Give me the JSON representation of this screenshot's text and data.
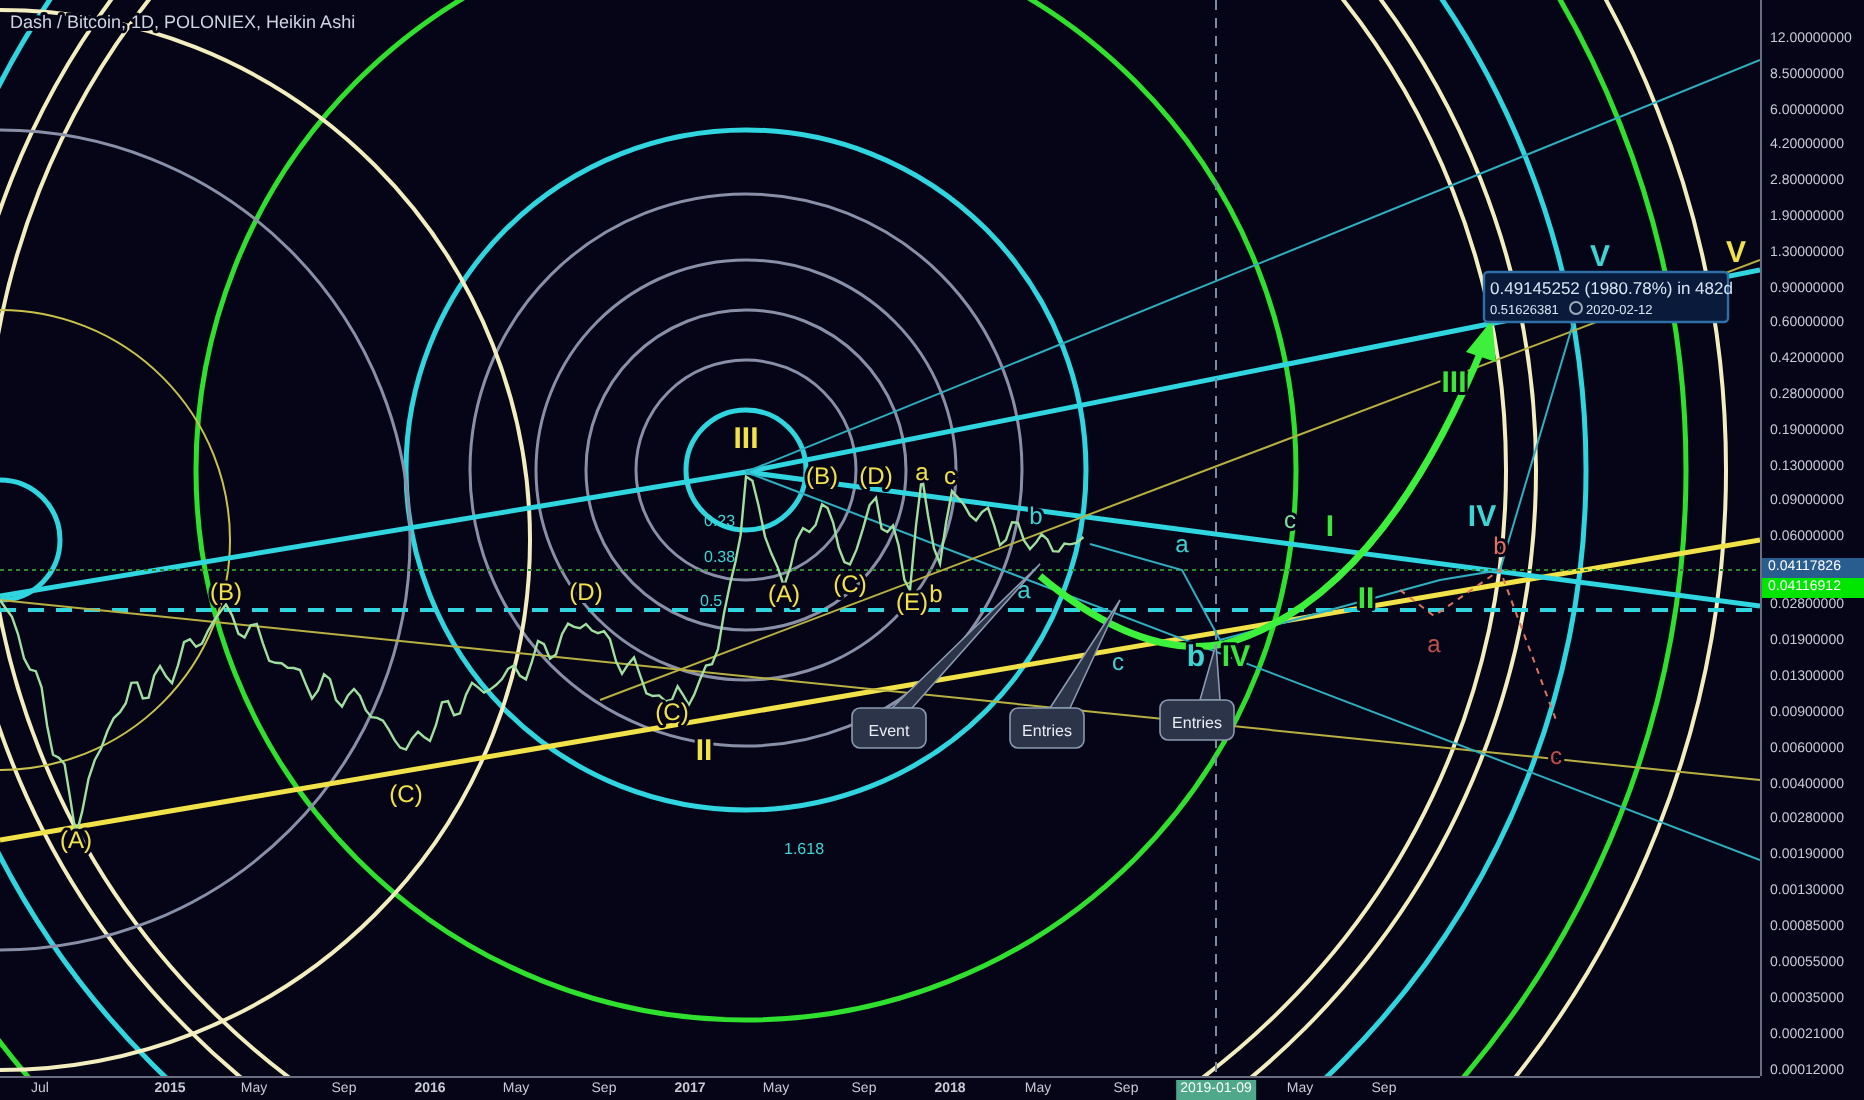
{
  "title": "Dash / Bitcoin, 1D, POLONIEX, Heikin Ashi",
  "price_axis": [
    "12.00000000",
    "8.50000000",
    "6.00000000",
    "4.20000000",
    "2.80000000",
    "1.90000000",
    "1.30000000",
    "0.90000000",
    "0.60000000",
    "0.42000000",
    "0.28000000",
    "0.19000000",
    "0.13000000",
    "0.09000000",
    "0.06000000",
    "0.02800000",
    "0.01900000",
    "0.01300000",
    "0.00900000",
    "0.00600000",
    "0.00400000",
    "0.00280000",
    "0.00190000",
    "0.00130000",
    "0.00085000",
    "0.00055000",
    "0.00035000",
    "0.00021000",
    "0.00012000"
  ],
  "current_prices": [
    {
      "value": "0.04117826",
      "color": "#2a5d8f"
    },
    {
      "value": "0.04116912",
      "color": "#00e600"
    }
  ],
  "time_axis": [
    {
      "label": "Jul",
      "kind": "month",
      "highlighted": false
    },
    {
      "label": "2015",
      "kind": "year",
      "highlighted": false
    },
    {
      "label": "May",
      "kind": "month",
      "highlighted": false
    },
    {
      "label": "Sep",
      "kind": "month",
      "highlighted": false
    },
    {
      "label": "2016",
      "kind": "year",
      "highlighted": false
    },
    {
      "label": "May",
      "kind": "month",
      "highlighted": false
    },
    {
      "label": "Sep",
      "kind": "month",
      "highlighted": false
    },
    {
      "label": "2017",
      "kind": "year",
      "highlighted": false
    },
    {
      "label": "May",
      "kind": "month",
      "highlighted": false
    },
    {
      "label": "Sep",
      "kind": "month",
      "highlighted": false
    },
    {
      "label": "2018",
      "kind": "year",
      "highlighted": false
    },
    {
      "label": "May",
      "kind": "month",
      "highlighted": false
    },
    {
      "label": "Sep",
      "kind": "month",
      "highlighted": false
    },
    {
      "label": "2019-01-09",
      "kind": "date",
      "highlighted": true
    },
    {
      "label": "May",
      "kind": "month",
      "highlighted": false
    },
    {
      "label": "Sep",
      "kind": "month",
      "highlighted": false
    }
  ],
  "wave_labels": [
    {
      "text": "(A)",
      "kind": "minor",
      "color": "#f2e24a"
    },
    {
      "text": "(B)",
      "kind": "minor",
      "color": "#f2e24a"
    },
    {
      "text": "(C)",
      "kind": "minor",
      "color": "#f2e24a"
    },
    {
      "text": "(D)",
      "kind": "minor",
      "color": "#f2e24a"
    },
    {
      "text": "(C)",
      "kind": "minor",
      "color": "#f2e24a"
    },
    {
      "text": "II",
      "kind": "major",
      "color": "#f2e24a"
    },
    {
      "text": "III",
      "kind": "major",
      "color": "#f2e24a"
    },
    {
      "text": "(A)",
      "kind": "minor",
      "color": "#f2e24a"
    },
    {
      "text": "(B)",
      "kind": "minor",
      "color": "#f2e24a"
    },
    {
      "text": "(C)",
      "kind": "minor",
      "color": "#f2e24a"
    },
    {
      "text": "(D)",
      "kind": "minor",
      "color": "#f2e24a"
    },
    {
      "text": "a",
      "kind": "minor",
      "color": "#f2e24a"
    },
    {
      "text": "c",
      "kind": "minor",
      "color": "#f2e24a"
    },
    {
      "text": "(E)",
      "kind": "minor",
      "color": "#f2e24a"
    },
    {
      "text": "b",
      "kind": "minor",
      "color": "#f2e24a"
    },
    {
      "text": "b",
      "kind": "minor",
      "color": "#3fd4d4"
    },
    {
      "text": "a",
      "kind": "minor",
      "color": "#3fd4d4"
    },
    {
      "text": "a",
      "kind": "minor",
      "color": "#3fd4d4"
    },
    {
      "text": "c",
      "kind": "minor",
      "color": "#3fd4d4"
    },
    {
      "text": "b",
      "kind": "major",
      "color": "#3fd4d4"
    },
    {
      "text": "IV",
      "kind": "major",
      "color": "#39e639"
    },
    {
      "text": "c",
      "kind": "minor",
      "color": "#7ee0a0"
    },
    {
      "text": "I",
      "kind": "major",
      "color": "#39e639"
    },
    {
      "text": "II",
      "kind": "major",
      "color": "#39e639"
    },
    {
      "text": "III",
      "kind": "major",
      "color": "#39e639"
    },
    {
      "text": "IV",
      "kind": "major",
      "color": "#3fd4d4"
    },
    {
      "text": "V",
      "kind": "major",
      "color": "#3fd4d4"
    },
    {
      "text": "V",
      "kind": "major",
      "color": "#f2e24a"
    },
    {
      "text": "b",
      "kind": "minor",
      "color": "#e0735f"
    },
    {
      "text": "a",
      "kind": "minor",
      "color": "#c0504a"
    },
    {
      "text": "c",
      "kind": "minor",
      "color": "#c0504a"
    }
  ],
  "fib_labels": [
    "0.23",
    "0.38",
    "0.5",
    "1.618"
  ],
  "callouts": [
    "Event",
    "Entries",
    "Entries"
  ],
  "measure": {
    "change": "0.49145252 (1980.78%) in 482d",
    "price": "0.51626381",
    "date": "2020-02-12"
  }
}
